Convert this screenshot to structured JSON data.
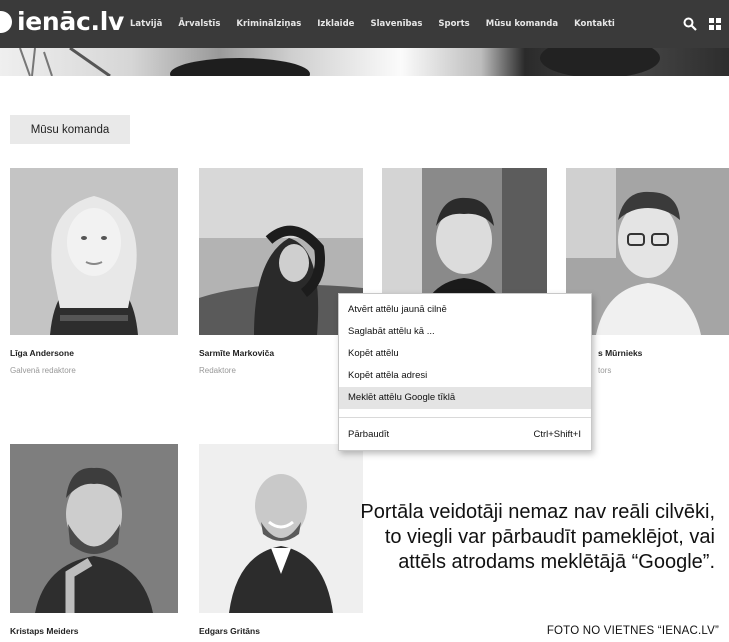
{
  "site": {
    "logo": "ienāc.lv"
  },
  "nav": [
    "Latvijā",
    "Ārvalstīs",
    "Kriminālziņas",
    "Izklaide",
    "Slavenības",
    "Sports",
    "Mūsu komanda",
    "Kontakti"
  ],
  "icons": {
    "search": "search-icon",
    "menu": "grid-menu-icon"
  },
  "section_button": "Mūsu komanda",
  "team": [
    {
      "name": "Līga Andersone",
      "role": "Galvenā redaktore"
    },
    {
      "name": "Sarmīte Markoviča",
      "role": "Redaktore"
    },
    {
      "name": "",
      "role": ""
    },
    {
      "name": "s Mūrnieks",
      "role": "tors"
    },
    {
      "name": "Kristaps Meiders",
      "role": ""
    },
    {
      "name": "Edgars Gritāns",
      "role": ""
    }
  ],
  "context_menu": {
    "items": [
      {
        "label": "Atvērt attēlu jaunā cilnē",
        "shortcut": ""
      },
      {
        "label": "Saglabāt attēlu kā ...",
        "shortcut": ""
      },
      {
        "label": "Kopēt attēlu",
        "shortcut": ""
      },
      {
        "label": "Kopēt attēla adresi",
        "shortcut": ""
      },
      {
        "label": "Meklēt attēlu Google tīklā",
        "shortcut": ""
      },
      {
        "label": "Pārbaudīt",
        "shortcut": "Ctrl+Shift+I"
      }
    ],
    "highlighted_index": 4
  },
  "caption": "Portāla veidotāji nemaz nav reāli cilvēki, to viegli var pārbaudīt pameklējot, vai attēls atrodams meklētājā “Google”.",
  "credit": "FOTO NO VIETNES “IENAC.LV”",
  "colors": {
    "topbar": "#3a3a3a",
    "button_bg": "#e9e9e9",
    "highlight": "#e4e4e4",
    "role_text": "#999999"
  }
}
